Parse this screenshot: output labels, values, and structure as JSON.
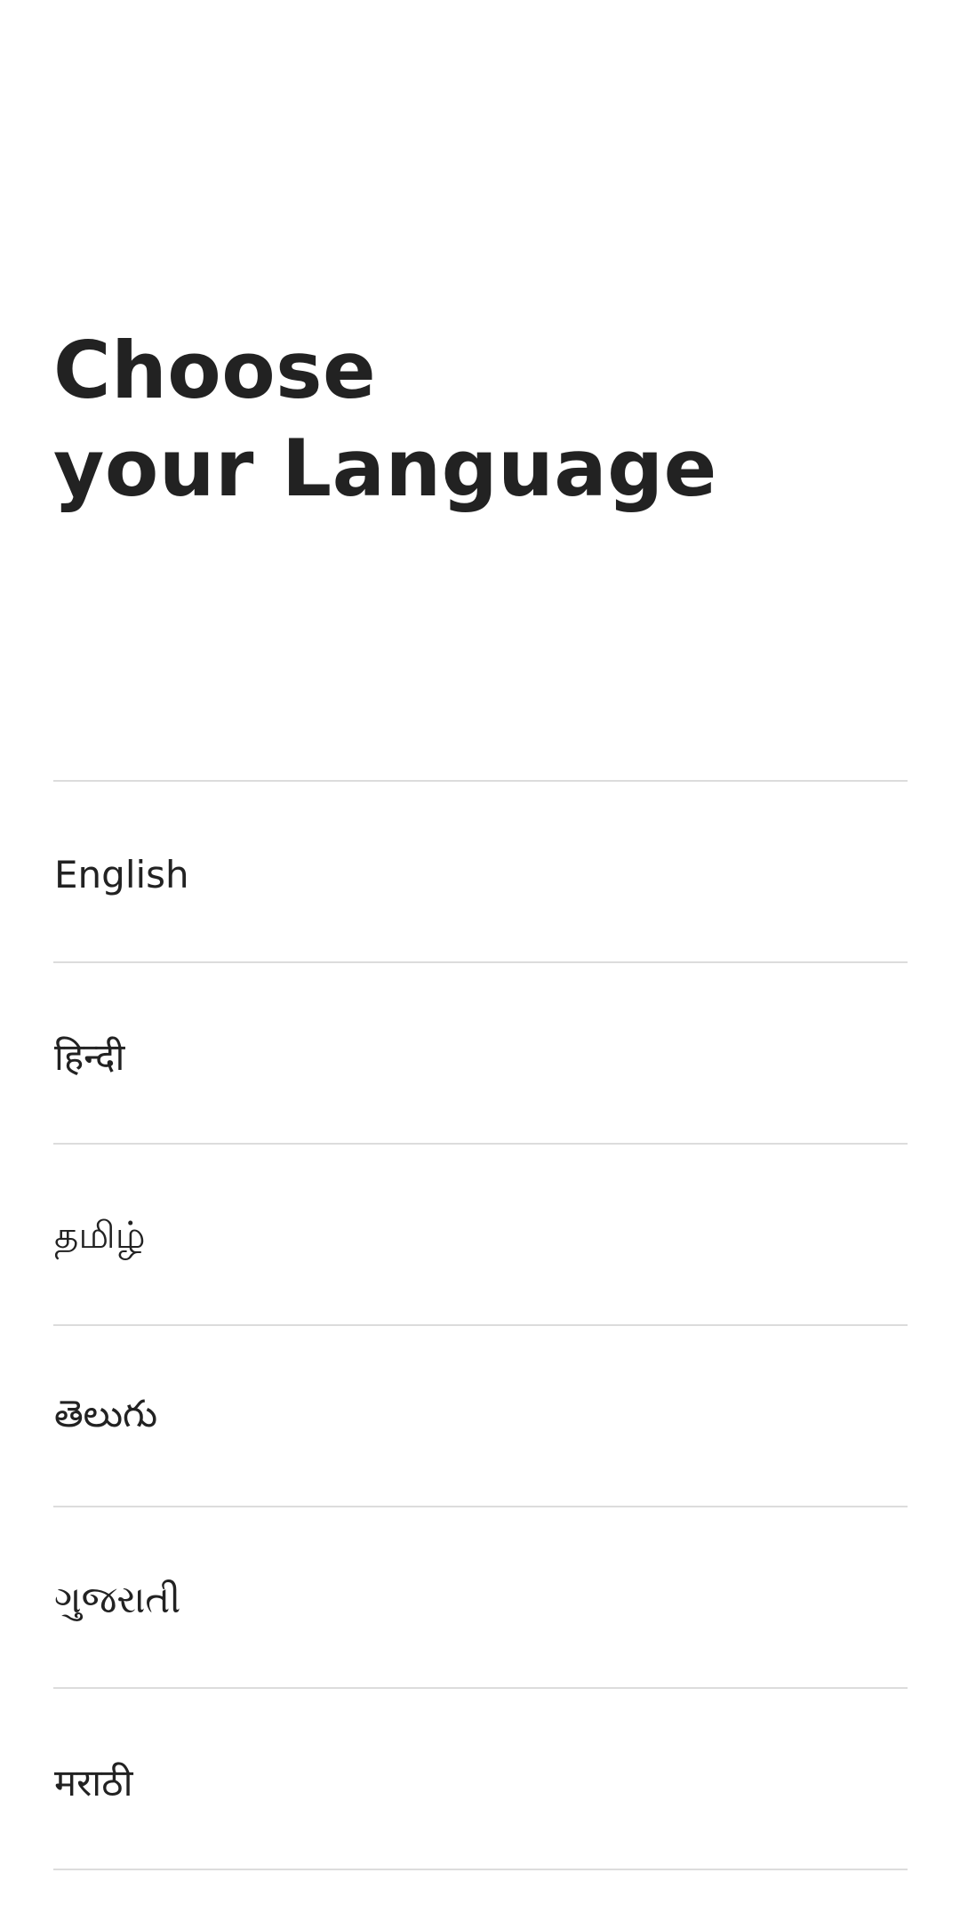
{
  "header": {
    "title_line1": "Choose",
    "title_line2": "your Language"
  },
  "languages": [
    {
      "label": "English"
    },
    {
      "label": "हिन्दी"
    },
    {
      "label": "தமிழ்"
    },
    {
      "label": "తెలుగు"
    },
    {
      "label": "ગુજરાતી"
    },
    {
      "label": "मराठी"
    }
  ],
  "colors": {
    "text": "#222222",
    "divider": "#dcdcdc",
    "background": "#ffffff"
  }
}
